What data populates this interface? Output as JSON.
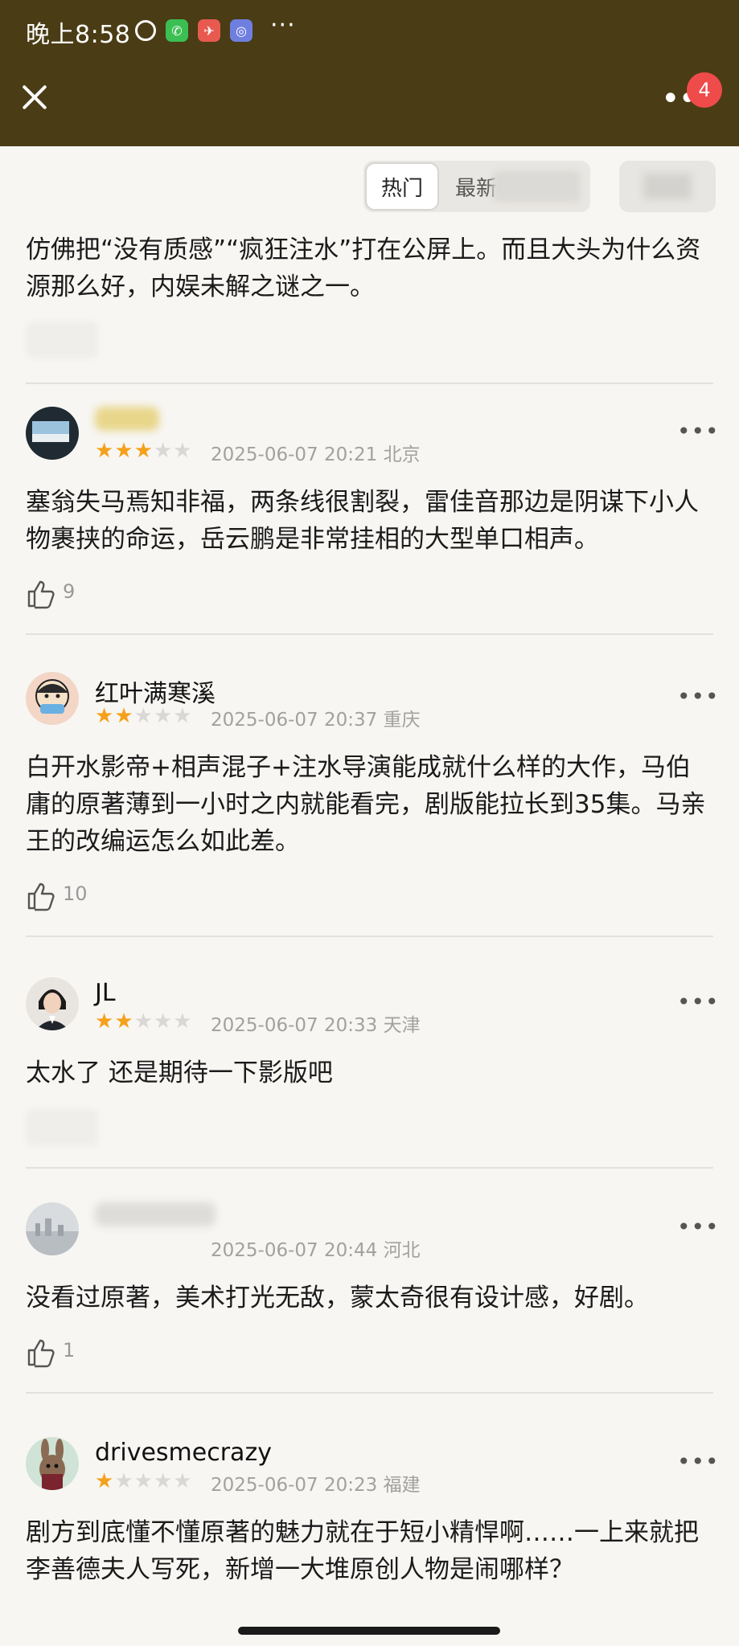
{
  "status_bar": {
    "time": "晚上8:58",
    "icons": [
      "clock-icon",
      "wechat-icon",
      "message-app-icon",
      "app-icon"
    ],
    "more": "···"
  },
  "title_bar": {
    "badge_count": "4",
    "more": "••"
  },
  "tabs": {
    "hot_label": "热门",
    "new_label": "最新"
  },
  "first_comment_tail": {
    "text": "仿佛把“没有质感”“疯狂注水”打在公屏上。而且大头为什么资源那么好，内娱未解之谜之一。"
  },
  "comments": [
    {
      "username": "",
      "stars": 3,
      "datetime": "2025-06-07 20:21",
      "location": "北京",
      "text": "塞翁失马焉知非福，两条线很割裂，雷佳音那边是阴谋下小人物裹挟的命运，岳云鹏是非常挂相的大型单口相声。",
      "likes": "9"
    },
    {
      "username": "红叶满寒溪",
      "stars": 2,
      "datetime": "2025-06-07 20:37",
      "location": "重庆",
      "text": "白开水影帝+相声混子+注水导演能成就什么样的大作，马伯庸的原著薄到一小时之内就能看完，剧版能拉长到35集。马亲王的改编运怎么如此差。",
      "likes": "10"
    },
    {
      "username": "JL",
      "stars": 2,
      "datetime": "2025-06-07 20:33",
      "location": "天津",
      "text": "太水了 还是期待一下影版吧",
      "likes": ""
    },
    {
      "username": "",
      "stars": 0,
      "datetime": "2025-06-07 20:44",
      "location": "河北",
      "text": "没看过原著，美术打光无敌，蒙太奇很有设计感，好剧。",
      "likes": "1"
    },
    {
      "username": "drivesmecrazy",
      "stars": 1,
      "datetime": "2025-06-07 20:23",
      "location": "福建",
      "text": "剧方到底懂不懂原著的魅力就在于短小精悍啊……一上来就把李善德夫人写死，新增一大堆原创人物是闹哪样？",
      "likes": ""
    }
  ],
  "colors": {
    "header_bg": "#4a3c14",
    "star_on": "#f5a11c",
    "star_off": "#d9d8d5",
    "badge": "#ef4b4b"
  }
}
